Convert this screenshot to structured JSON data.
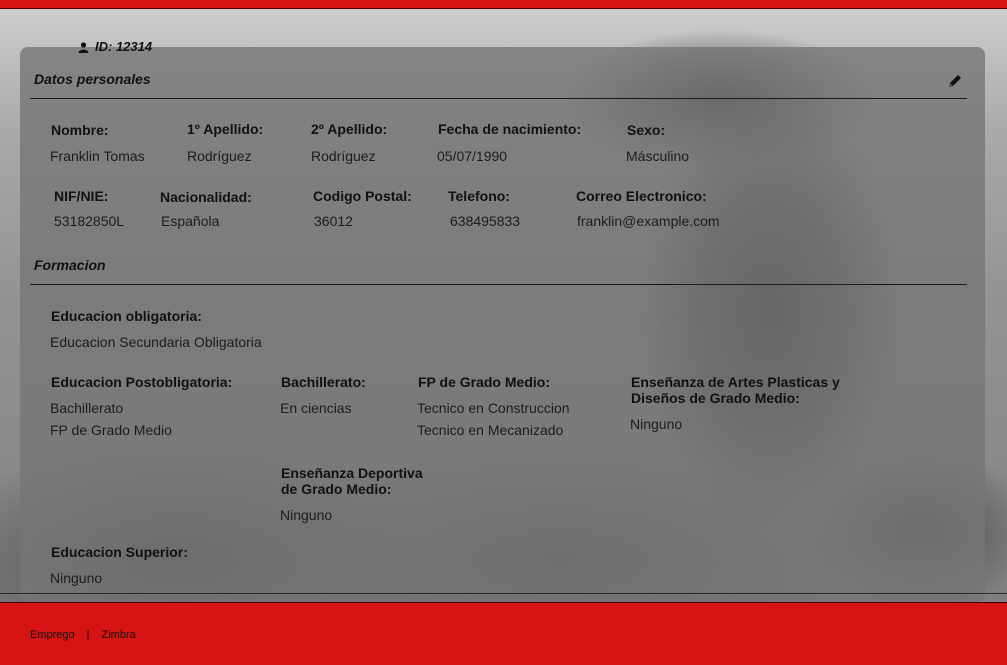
{
  "header": {
    "id_label": "ID: 12314"
  },
  "personal": {
    "section_title": "Datos personales",
    "fields": {
      "nombre": {
        "label": "Nombre:",
        "value": "Franklin Tomas"
      },
      "apellido1": {
        "label": "1º Apellido:",
        "value": "Rodríguez"
      },
      "apellido2": {
        "label": "2º Apellido:",
        "value": "Rodríguez"
      },
      "fecha": {
        "label": "Fecha de nacimiento:",
        "value": "05/07/1990"
      },
      "sexo": {
        "label": "Sexo:",
        "value": "Másculino"
      },
      "nif": {
        "label": "NIF/NIE:",
        "value": "53182850L"
      },
      "nacionalidad": {
        "label": "Nacionalidad:",
        "value": "Española"
      },
      "cp": {
        "label": "Codigo Postal:",
        "value": "36012"
      },
      "telefono": {
        "label": "Telefono:",
        "value": "638495833"
      },
      "correo": {
        "label": "Correo Electronico:",
        "value": "franklin@example.com"
      }
    }
  },
  "formacion": {
    "section_title": "Formacion",
    "obligatoria": {
      "label": "Educacion obligatoria:",
      "value": "Educacion Secundaria Obligatoria"
    },
    "postobligatoria": {
      "label": "Educacion Postobligatoria:",
      "values": [
        "Bachillerato",
        "FP de Grado Medio"
      ]
    },
    "bachillerato": {
      "label": "Bachillerato:",
      "value": "En ciencias"
    },
    "fp_medio": {
      "label": "FP de Grado Medio:",
      "values": [
        "Tecnico en Construccion",
        "Tecnico en Mecanizado"
      ]
    },
    "artes": {
      "label_line1": "Enseñanza de Artes Plasticas y",
      "label_line2": "Diseños de Grado Medio:",
      "value": "Ninguno"
    },
    "deportiva": {
      "label_line1": "Enseñanza Deportiva",
      "label_line2": "de Grado Medio:",
      "value": "Ninguno"
    },
    "superior": {
      "label": "Educacion Superior:",
      "value": "Ninguno"
    }
  },
  "footer": {
    "link1": "Emprego",
    "separator": "|",
    "link2": "Zimbra"
  },
  "colors": {
    "brand_red": "#d71414"
  }
}
